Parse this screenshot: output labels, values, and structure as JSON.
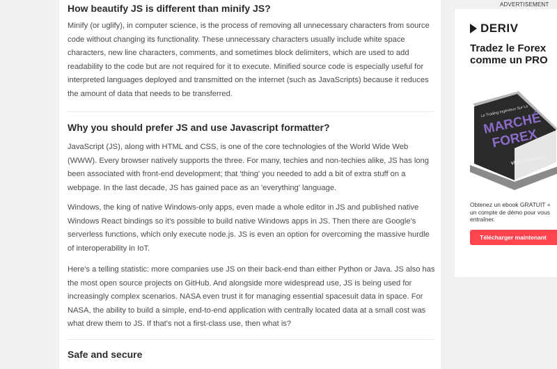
{
  "article": {
    "heading1": "How beautify JS is different than minify JS?",
    "para1": "Minify (or uglify), in computer science, is the process of removing all unnecessary characters from source code without changing its functionality. These unnecessary characters usually include white space characters, new line characters, comments, and sometimes block delimiters, which are used to add readability to the code but are not required for it to execute. Minified source code is especially useful for interpreted languages deployed and transmitted on the internet (such as JavaScripts) because it reduces the amount of data that needs to be transferred.",
    "heading2": "Why you should prefer JS and use Javascript formatter?",
    "para2": "JavaScript (JS), along with HTML and CSS, is one of the core technologies of the World Wide Web (WWW). Every browser natively supports the three. For many, techies and non-techies alike, JS has long been associated with front-end development; that 'thing' you needed to add a bit of extra stuff on a webpage. In the last decade, JS has gained pace as an 'everything' language.",
    "para3": "Windows, the king of native Windows-only apps, even made a whole editor in JS and published native Windows React bindings so it's possible to build native Windows apps in JS. Then there are Google's serverless functions, which only execute node.js. JS is even an option for overcoming the massive hurdle of interoperability in IoT.",
    "para4": "Here's a telling statistic: more companies use JS on their back-end than either Python or Java. JS also has the most open source projects on GitHub. And alongside more widespread use, JS is being used for increasingly complex scenarios. NASA even trust it for managing essential spacesuit data in space. For NASA, the ability to build a simple, end-to-end application with centrally located data at a small cost was what drew them to JS. If that's not a first-class use, then what is?",
    "heading3": "Safe and secure"
  },
  "ad": {
    "label": "ADVERTISEMENT",
    "brand": "DERIV",
    "headline": "Tradez le Forex comme un PRO",
    "book_top": "Le Trading Ingénieux Sur Le",
    "book_title_1": "MARCHÉ",
    "book_title_2": "FOREX",
    "book_author": "Vince Stanzione",
    "body": "Obtenez un ebook GRATUIT + un compte de démo pour vous entraîner.",
    "cta": "Télécharger maintenant",
    "cta_color": "#ff444f"
  }
}
